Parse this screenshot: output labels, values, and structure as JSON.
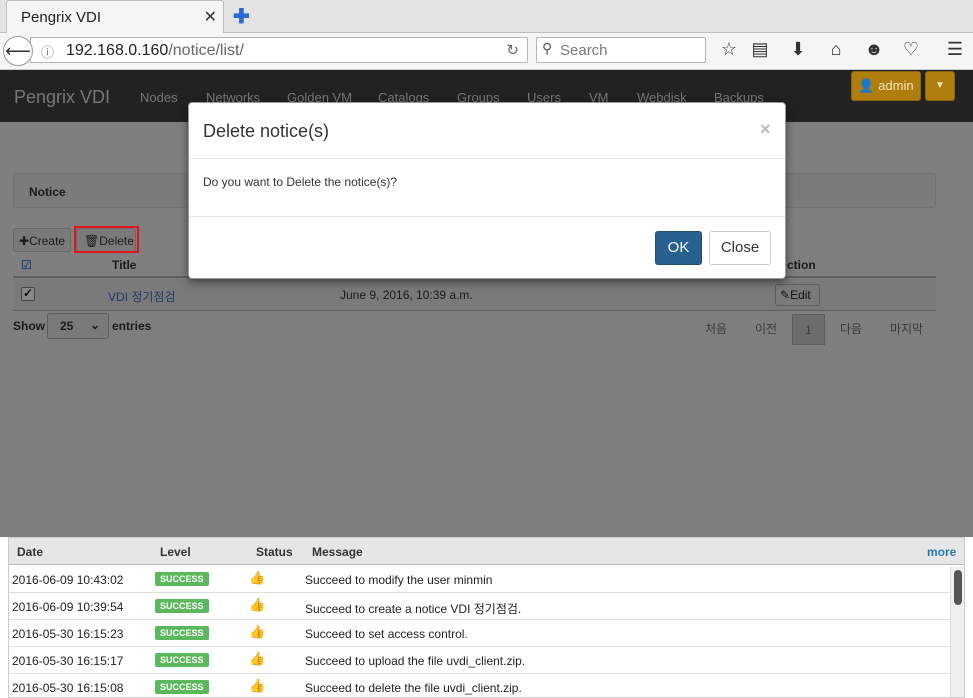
{
  "browser": {
    "tab_title": "Pengrix VDI",
    "tab_close": "✕",
    "new_tab": "✚",
    "url_host": "192.168.0.160",
    "url_path": "/notice/list/",
    "search_placeholder": "Search"
  },
  "app": {
    "brand": "Pengrix VDI",
    "menu": [
      "Nodes",
      "Networks",
      "Golden VM",
      "Catalogs",
      "Groups",
      "Users",
      "VM",
      "Webdisk",
      "Backups"
    ],
    "user_label": "admin"
  },
  "page": {
    "panel_title": "Notice",
    "create_label": "Create",
    "delete_label": "Delete",
    "columns": {
      "title": "Title",
      "action": "ction"
    },
    "rows": [
      {
        "title": "VDI 정기점검",
        "date": "June 9, 2016, 10:39 a.m.",
        "action": "Edit",
        "checked": true
      }
    ],
    "show_label": "Show",
    "page_size": "25",
    "entries_label": "entries",
    "pagination": [
      "처음",
      "이전",
      "1",
      "다음",
      "마지막"
    ]
  },
  "modal": {
    "title": "Delete notice(s)",
    "close_x": "×",
    "message": "Do you want to Delete the notice(s)?",
    "ok_label": "OK",
    "close_label": "Close"
  },
  "logs": {
    "columns": [
      "Date",
      "Level",
      "Status",
      "Message"
    ],
    "more_label": "more",
    "rows": [
      {
        "date": "2016-06-09 10:43:02",
        "level": "SUCCESS",
        "message": "Succeed to modify the user minmin"
      },
      {
        "date": "2016-06-09 10:39:54",
        "level": "SUCCESS",
        "message": "Succeed to create a notice VDI 정기점검."
      },
      {
        "date": "2016-05-30 16:15:23",
        "level": "SUCCESS",
        "message": "Succeed to set access control."
      },
      {
        "date": "2016-05-30 16:15:17",
        "level": "SUCCESS",
        "message": "Succeed to upload the file uvdi_client.zip."
      },
      {
        "date": "2016-05-30 16:15:08",
        "level": "SUCCESS",
        "message": "Succeed to delete the file uvdi_client.zip."
      }
    ],
    "success_color": "#5cb85c"
  }
}
